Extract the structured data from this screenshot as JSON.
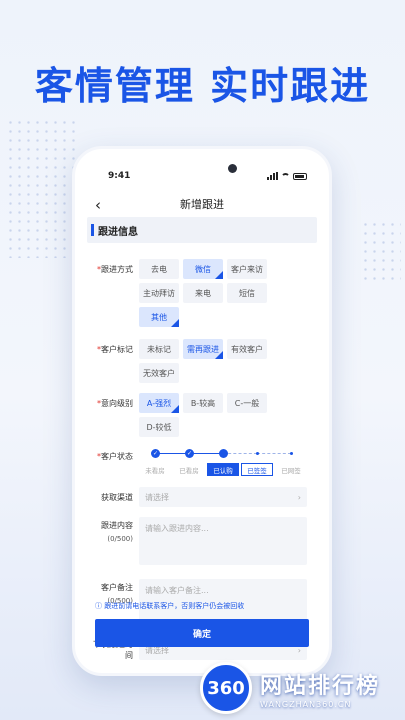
{
  "promo": {
    "title": "客情管理 实时跟进"
  },
  "status": {
    "time": "9:41"
  },
  "nav": {
    "back_icon": "chevron-left-icon",
    "title": "新增跟进"
  },
  "section": {
    "title": "跟进信息"
  },
  "follow_method": {
    "label": "跟进方式",
    "options": [
      "去电",
      "微信",
      "客户来访",
      "主动拜访",
      "来电",
      "短信",
      "其他"
    ],
    "selected": [
      "微信",
      "其他"
    ]
  },
  "customer_tag": {
    "label": "客户标记",
    "options": [
      "未标记",
      "需再跟进",
      "有效客户",
      "无效客户"
    ],
    "selected": [
      "需再跟进"
    ]
  },
  "intent_level": {
    "label": "意向级别",
    "options": [
      "A-强烈",
      "B-较高",
      "C-一般",
      "D-较低"
    ],
    "selected": [
      "A-强烈"
    ]
  },
  "customer_status": {
    "label": "客户状态",
    "steps": [
      "未看房",
      "已看房",
      "已认购",
      "已签签",
      "已网签"
    ],
    "active": "已认购"
  },
  "channel": {
    "label": "获取渠道",
    "placeholder": "请选择"
  },
  "content": {
    "label": "跟进内容",
    "counter": "(0/500)",
    "placeholder": "请输入跟进内容..."
  },
  "remark": {
    "label": "客户备注",
    "counter": "(0/500)",
    "placeholder": "请输入客户备注..."
  },
  "next_time": {
    "label": "下次跟进时间",
    "placeholder": "请选择"
  },
  "hint": "ⓘ 跟进前请电话联系客户，否则客户仍会被回收",
  "confirm_label": "确定",
  "brand": {
    "logo_text": "360",
    "name": "网站排行榜",
    "url": "WANGZHAN360.CN"
  },
  "colors": {
    "accent": "#1a55e6",
    "required": "#e0342d"
  }
}
